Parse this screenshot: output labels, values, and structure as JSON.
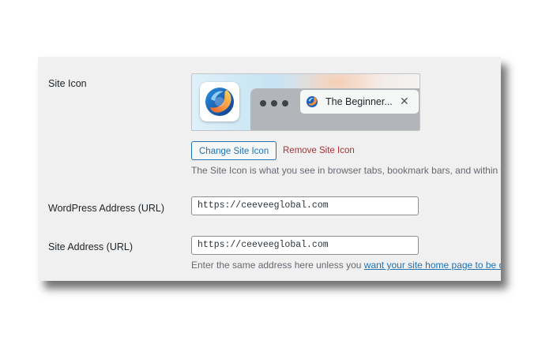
{
  "site_icon": {
    "label": "Site Icon",
    "preview": {
      "tab_title": "The Beginner...",
      "close_glyph": "✕"
    },
    "change_button": "Change Site Icon",
    "remove_button": "Remove Site Icon",
    "description": "The Site Icon is what you see in browser tabs, bookmark bars, and within the"
  },
  "wordpress_address": {
    "label": "WordPress Address (URL)",
    "value": "https://ceeveeglobal.com"
  },
  "site_address": {
    "label": "Site Address (URL)",
    "value": "https://ceeveeglobal.com",
    "help_text": "Enter the same address here unless you ",
    "help_link": "want your site home page to be diffe"
  },
  "colors": {
    "panel_bg": "#f0f0f1",
    "link": "#2271b1",
    "danger": "#b32d2e",
    "muted_text": "#646970"
  },
  "icons": [
    "site-logo-icon",
    "browser-dot-icon",
    "tab-close-icon"
  ]
}
